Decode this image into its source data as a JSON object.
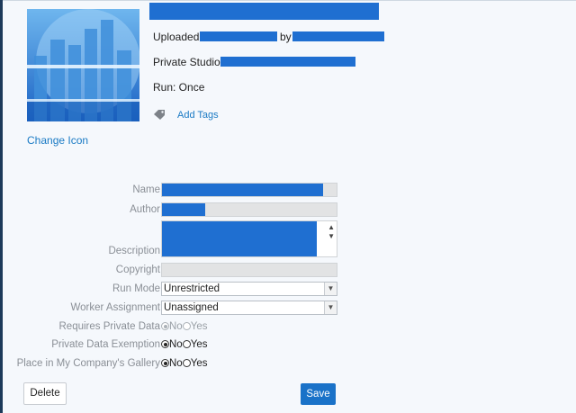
{
  "header": {
    "uploaded_label": "Uploaded:",
    "by_label": "by",
    "private_studio_label": "Private Studio:",
    "run_label": "Run: Once",
    "add_tags": "Add Tags",
    "change_icon": "Change Icon"
  },
  "form": {
    "name_label": "Name",
    "author_label": "Author",
    "description_label": "Description",
    "copyright_label": "Copyright",
    "run_mode_label": "Run Mode",
    "run_mode_value": "Unrestricted",
    "worker_assignment_label": "Worker Assignment",
    "worker_assignment_value": "Unassigned",
    "requires_private_data_label": "Requires Private Data",
    "private_data_exemption_label": "Private Data Exemption",
    "company_gallery_label": "Place in My Company's Gallery",
    "no_option": "No",
    "yes_option": "Yes"
  },
  "buttons": {
    "delete": "Delete",
    "save": "Save"
  },
  "colors": {
    "accent": "#1a72c8",
    "redaction": "#1f6fd1",
    "link": "#1a7ac4"
  }
}
